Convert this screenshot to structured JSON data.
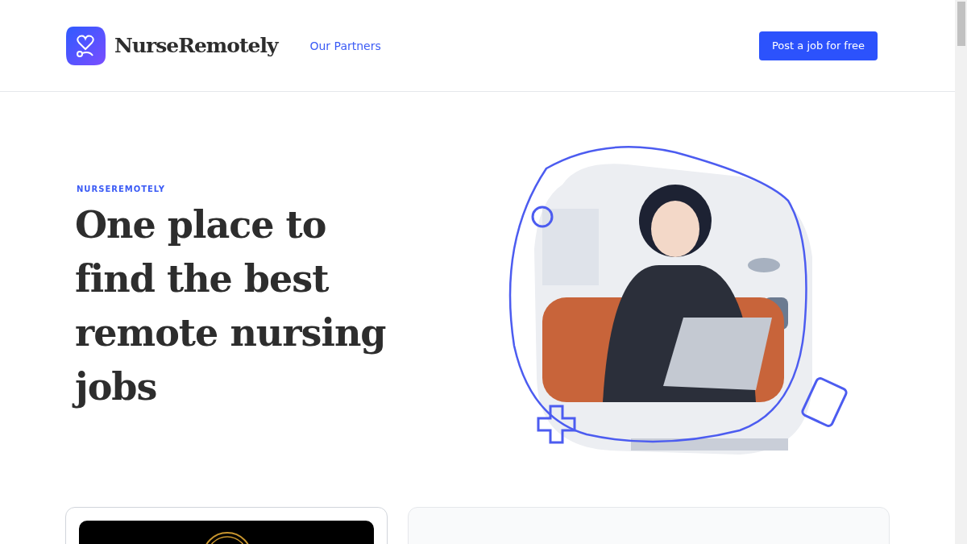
{
  "header": {
    "brand": "NurseRemotely",
    "nav": [
      {
        "label": "Our Partners"
      }
    ],
    "cta": "Post a job for free"
  },
  "hero": {
    "eyebrow": "NURSEREMOTELY",
    "title": "One place to find the best remote nursing jobs"
  },
  "cards": [
    {
      "kind": "media"
    },
    {
      "kind": "text"
    }
  ]
}
